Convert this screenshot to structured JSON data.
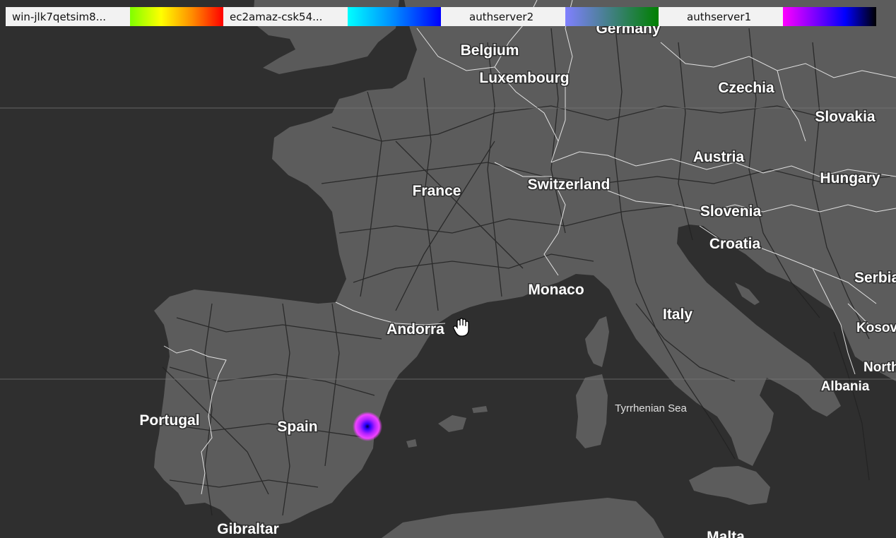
{
  "legend": {
    "items": [
      {
        "label": "win-jlk7qetsim8...",
        "gradient": [
          "#7fff00",
          "#ffff00",
          "#ff8c00",
          "#ff0000"
        ]
      },
      {
        "label": "ec2amaz-csk54...",
        "gradient": [
          "#00ffff",
          "#0088ff",
          "#0000ff"
        ]
      },
      {
        "label": "authserver2",
        "gradient": [
          "#8080ff",
          "#408080",
          "#008000"
        ]
      },
      {
        "label": "authserver1",
        "gradient": [
          "#ff00ff",
          "#8000ff",
          "#0000ff",
          "#000000"
        ]
      }
    ]
  },
  "map": {
    "land_color": "#5c5c5c",
    "sea_color": "#2f2f2f",
    "countries": [
      "Germany",
      "Belgium",
      "Luxembourg",
      "Czechia",
      "Slovakia",
      "France",
      "Switzerland",
      "Austria",
      "Hungary",
      "Slovenia",
      "Croatia",
      "Serbia",
      "Monaco",
      "Italy",
      "Andorra",
      "Kosovo",
      "North Macedonia",
      "Albania",
      "Portugal",
      "Spain",
      "Gibraltar",
      "Malta"
    ],
    "seas": [
      "Tyrrhenian Sea"
    ],
    "labels": {
      "germany": "Germany",
      "belgium": "Belgium",
      "luxembourg": "Luxembourg",
      "czechia": "Czechia",
      "slovakia": "Slovakia",
      "france": "France",
      "switzerland": "Switzerland",
      "austria": "Austria",
      "hungary": "Hungary",
      "slovenia": "Slovenia",
      "croatia": "Croatia",
      "serbia": "Serbia",
      "monaco": "Monaco",
      "italy": "Italy",
      "andorra": "Andorra",
      "kosovo": "Kosovo",
      "north_macedonia": "North Macedonia",
      "albania": "Albania",
      "portugal": "Portugal",
      "spain": "Spain",
      "gibraltar": "Gibraltar",
      "malta": "Malta",
      "tyrrhenian_sea": "Tyrrhenian Sea"
    },
    "heat_point": {
      "series": "authserver1",
      "colors": [
        "#000066",
        "#3a00ff",
        "#cc22ff",
        "#ff44ff"
      ]
    }
  }
}
